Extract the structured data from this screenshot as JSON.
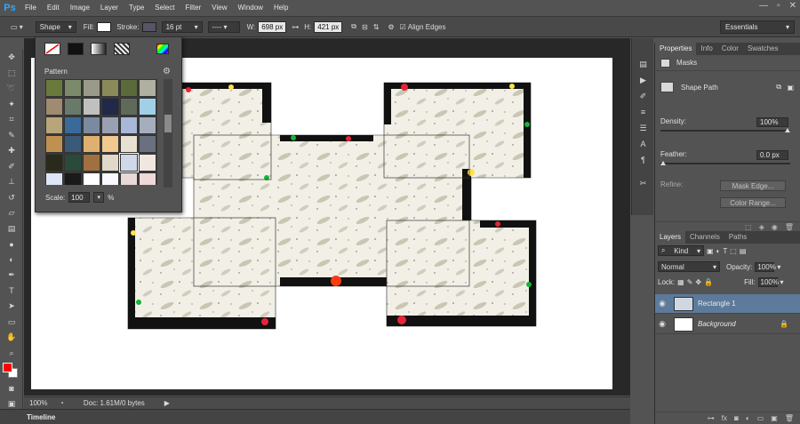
{
  "app": {
    "logo": "Ps"
  },
  "menu": [
    "File",
    "Edit",
    "Image",
    "Layer",
    "Type",
    "Select",
    "Filter",
    "View",
    "Window",
    "Help"
  ],
  "window_controls": [
    "—",
    "▫",
    "✕"
  ],
  "options_bar": {
    "tool_mode": "Shape",
    "fill_label": "Fill:",
    "stroke_label": "Stroke:",
    "stroke_width": "16 pt",
    "w_label": "W:",
    "w_value": "698 px",
    "h_label": "H:",
    "h_value": "421 px",
    "align_edges": "Align Edges",
    "workspace": "Essentials"
  },
  "pattern_picker": {
    "title": "Pattern",
    "scale_label": "Scale:",
    "scale_value": "100",
    "scale_unit": "%",
    "swatches": [
      "#6a7a3c",
      "#7a8a6a",
      "#9a9a8a",
      "#8a8a5a",
      "#5a6a3a",
      "#b0b0a0",
      "#a08a70",
      "#6a7a6a",
      "#c0c0c0",
      "#202a48",
      "#606a5a",
      "#a0d0e8",
      "#b8a67a",
      "#3a6a9a",
      "#7a8aa0",
      "#9aa0b4",
      "#a8b8d8",
      "#a6aebe",
      "#c09050",
      "#3a5a7a",
      "#e0b070",
      "#f0c890",
      "#e8e0d0",
      "#6a7080",
      "#2a2a1a",
      "#2a4a3a",
      "#a07040",
      "#e0d8c8",
      "#d0d8e8",
      "#f0e8e0",
      "#dde6f8",
      "#1a1a1a",
      "#ffffff",
      "#f8f8ff",
      "#e8d8d8",
      "#f0d8d8"
    ]
  },
  "properties_panel": {
    "tabs": [
      "Properties",
      "Info",
      "Color",
      "Swatches"
    ],
    "section": "Masks",
    "shape_path": "Shape Path",
    "density_label": "Density:",
    "density_value": "100%",
    "feather_label": "Feather:",
    "feather_value": "0.0 px",
    "refine_label": "Refine:",
    "mask_edge": "Mask Edge...",
    "color_range": "Color Range..."
  },
  "layers_panel": {
    "tabs": [
      "Layers",
      "Channels",
      "Paths"
    ],
    "kind": "Kind",
    "blend_mode": "Normal",
    "opacity_label": "Opacity:",
    "opacity_value": "100%",
    "lock_label": "Lock:",
    "fill_label": "Fill:",
    "fill_value": "100%",
    "layers": [
      {
        "name": "Rectangle 1"
      },
      {
        "name": "Background"
      }
    ]
  },
  "status": {
    "zoom": "100%",
    "doc": "Doc: 1.61M/0 bytes"
  },
  "timeline": "Timeline",
  "colors": {
    "foreground": "#ff0000",
    "background": "#ffffff",
    "selection": "#5d7a9a"
  }
}
